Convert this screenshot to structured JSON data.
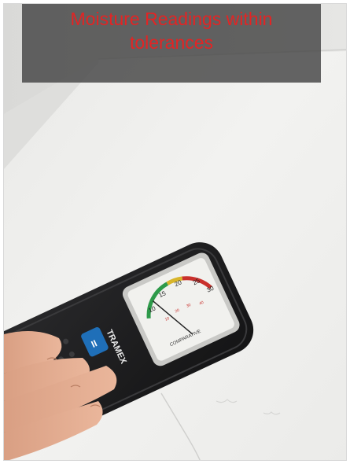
{
  "caption": {
    "text": "Moisture Readings within tolerances",
    "color": "#e32424",
    "box_color": "#484848"
  },
  "photo": {
    "meter_brand": "TRAMEX",
    "meter_button_symbol": "II",
    "gauge_scale_upper": [
      "10",
      "15",
      "20",
      "25",
      "30"
    ],
    "gauge_scale_lower": [
      "10",
      "20",
      "30",
      "40"
    ],
    "gauge_label": "COMPARATIVE",
    "palette": {
      "wall": "#ededeb",
      "meter_body": "#1d1d1f",
      "gauge_face": "#f1f1ee",
      "green_band": "#2e9a4a",
      "yellow_band": "#d8b52a",
      "red_band": "#c9302c",
      "led_red": "#ff2a2a",
      "button_blue": "#1f6fb8",
      "skin": "#e0a98c"
    }
  }
}
